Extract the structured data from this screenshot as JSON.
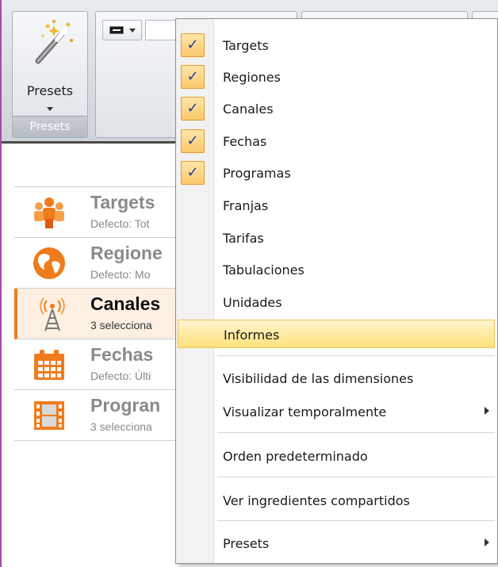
{
  "ribbon": {
    "presets_label": "Presets",
    "presets_group_caption": "Presets"
  },
  "list": [
    {
      "title": "Targets",
      "subtitle": "Defecto: Tot",
      "icon": "people-icon",
      "selected": false
    },
    {
      "title": "Regione",
      "subtitle": "Defecto: Mo",
      "icon": "globe-icon",
      "selected": false
    },
    {
      "title": "Canales",
      "subtitle": "3 selecciona",
      "icon": "antenna-icon",
      "selected": true
    },
    {
      "title": "Fechas",
      "subtitle": "Defecto: Últi",
      "icon": "calendar-icon",
      "selected": false
    },
    {
      "title": "Progran",
      "subtitle": "3 selecciona",
      "icon": "film-icon",
      "selected": false
    }
  ],
  "menu": {
    "check_glyph": "✓",
    "items": [
      {
        "label": "Targets",
        "checked": true
      },
      {
        "label": "Regiones",
        "checked": true
      },
      {
        "label": "Canales",
        "checked": true
      },
      {
        "label": "Fechas",
        "checked": true
      },
      {
        "label": "Programas",
        "checked": true
      },
      {
        "label": "Franjas",
        "checked": false
      },
      {
        "label": "Tarifas",
        "checked": false
      },
      {
        "label": "Tabulaciones",
        "checked": false
      },
      {
        "label": "Unidades",
        "checked": false
      },
      {
        "label": "Informes",
        "checked": false,
        "highlighted": true
      }
    ],
    "visibility_label": "Visibilidad de las dimensiones",
    "temp_label": "Visualizar temporalmente",
    "default_order_label": "Orden predeterminado",
    "shared_label": "Ver ingredientes compartidos",
    "presets_label": "Presets"
  },
  "colors": {
    "accent": "#f07b1c",
    "check_bg": "#fbc86b",
    "hover_bg": "#ffe07a",
    "frame": "#a64ca6"
  }
}
